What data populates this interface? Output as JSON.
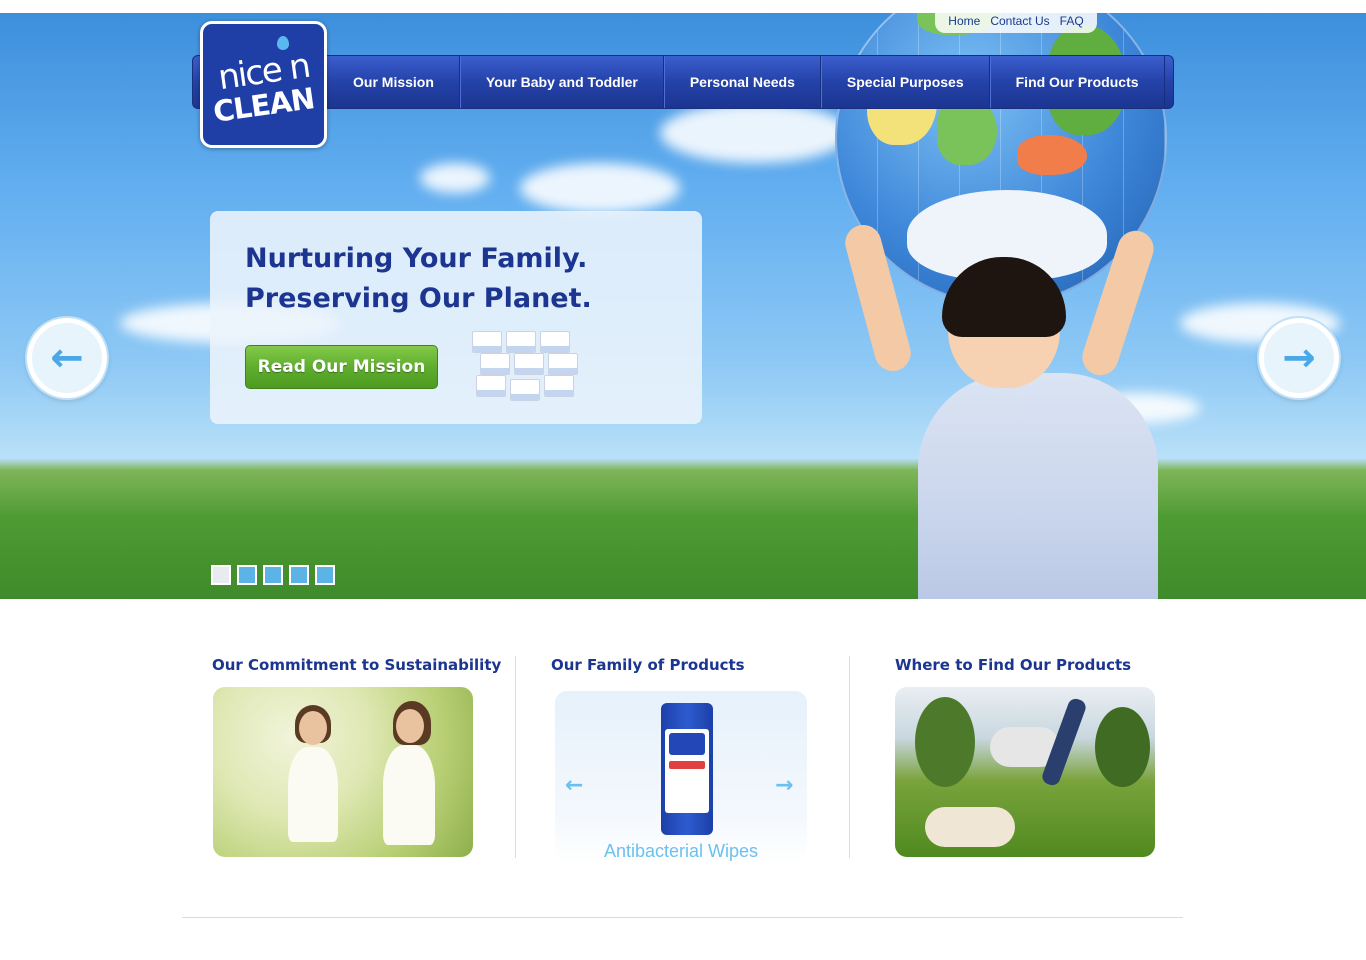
{
  "utility_links": [
    "Home",
    "Contact Us",
    "FAQ"
  ],
  "brand": {
    "line1": "nice n",
    "line2": "CLEAN"
  },
  "nav": [
    "Our Mission",
    "Your Baby and Toddler",
    "Personal Needs",
    "Special Purposes",
    "Find Our Products"
  ],
  "hero": {
    "headline_line1": "Nurturing Your Family.",
    "headline_line2": "Preserving Our Planet.",
    "cta": "Read Our Mission",
    "slides_total": 5,
    "active_slide": 1
  },
  "sections": {
    "sustainability": {
      "title": "Our Commitment to Sustainability"
    },
    "family": {
      "title": "Our Family of Products",
      "product_name": "Antibacterial Wipes"
    },
    "where": {
      "title": "Where to Find Our Products"
    }
  },
  "colors": {
    "brand_blue": "#1b3591",
    "cta_green": "#5fae2e",
    "accent_light_blue": "#6cc0ee"
  },
  "icons": {
    "prev": "arrow-left-icon",
    "next": "arrow-right-icon"
  }
}
